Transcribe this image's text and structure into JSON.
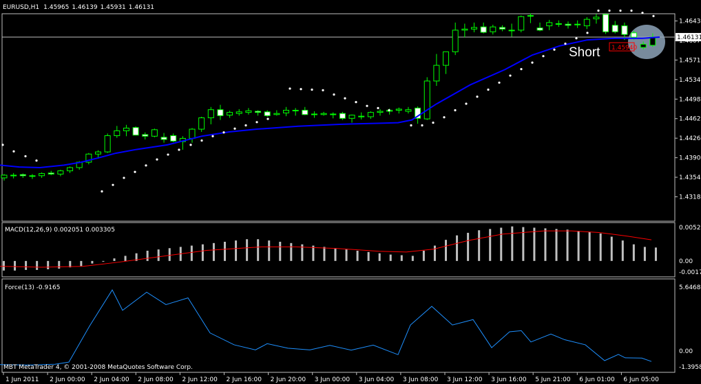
{
  "chart_data": {
    "type": "candlestick",
    "main": {
      "symbol_line": {
        "symbol": "EURUSD,H1",
        "open": "1.45965",
        "high": "1.46139",
        "low": "1.45931",
        "close": "1.46131"
      },
      "ylim": [
        1.4318,
        1.468
      ],
      "y_ticks": [
        "1.4643",
        "1.4607",
        "1.4571",
        "1.4534",
        "1.4498",
        "1.4462",
        "1.4426",
        "1.4390",
        "1.4354",
        "1.4318"
      ],
      "current_price": "1.46131",
      "sell_marker_price": "1.45940",
      "annotation": "Short",
      "candles": [
        [
          1.4353,
          1.436,
          1.4348,
          1.4358
        ],
        [
          1.4357,
          1.4362,
          1.4352,
          1.4358
        ],
        [
          1.4359,
          1.4361,
          1.4353,
          1.4357
        ],
        [
          1.4357,
          1.436,
          1.4351,
          1.4356
        ],
        [
          1.4357,
          1.4363,
          1.4353,
          1.4361
        ],
        [
          1.4362,
          1.4366,
          1.4358,
          1.436
        ],
        [
          1.436,
          1.4368,
          1.4356,
          1.4366
        ],
        [
          1.4366,
          1.4374,
          1.4362,
          1.4372
        ],
        [
          1.4372,
          1.4384,
          1.4368,
          1.4382
        ],
        [
          1.4382,
          1.4399,
          1.4378,
          1.4397
        ],
        [
          1.4397,
          1.4404,
          1.439,
          1.4401
        ],
        [
          1.4401,
          1.4435,
          1.4399,
          1.4431
        ],
        [
          1.4431,
          1.4449,
          1.4427,
          1.444
        ],
        [
          1.444,
          1.4451,
          1.443,
          1.4445
        ],
        [
          1.4446,
          1.4448,
          1.4436,
          1.4432
        ],
        [
          1.4433,
          1.4437,
          1.4424,
          1.443
        ],
        [
          1.443,
          1.4444,
          1.4428,
          1.4442
        ],
        [
          1.4428,
          1.4436,
          1.4418,
          1.4424
        ],
        [
          1.4431,
          1.4435,
          1.4419,
          1.4421
        ],
        [
          1.442,
          1.443,
          1.4405,
          1.4426
        ],
        [
          1.4426,
          1.4445,
          1.4418,
          1.4443
        ],
        [
          1.4443,
          1.4466,
          1.4438,
          1.4464
        ],
        [
          1.4464,
          1.4484,
          1.4452,
          1.4479
        ],
        [
          1.4479,
          1.4488,
          1.446,
          1.4468
        ],
        [
          1.4469,
          1.4477,
          1.4464,
          1.4474
        ],
        [
          1.4472,
          1.448,
          1.4468,
          1.4475
        ],
        [
          1.4474,
          1.4482,
          1.447,
          1.4477
        ],
        [
          1.4476,
          1.4478,
          1.4468,
          1.4474
        ],
        [
          1.4475,
          1.4478,
          1.4466,
          1.4468
        ],
        [
          1.447,
          1.4478,
          1.4468,
          1.4472
        ],
        [
          1.4473,
          1.4484,
          1.4467,
          1.4478
        ],
        [
          1.4478,
          1.4482,
          1.4468,
          1.4477
        ],
        [
          1.4478,
          1.4484,
          1.4469,
          1.447
        ],
        [
          1.4471,
          1.4476,
          1.4464,
          1.447
        ],
        [
          1.447,
          1.4475,
          1.4468,
          1.4472
        ],
        [
          1.4471,
          1.4474,
          1.4463,
          1.447
        ],
        [
          1.4472,
          1.4475,
          1.446,
          1.4463
        ],
        [
          1.4463,
          1.447,
          1.4455,
          1.4469
        ],
        [
          1.4467,
          1.4474,
          1.4461,
          1.4467
        ],
        [
          1.4466,
          1.4476,
          1.4462,
          1.4474
        ],
        [
          1.4474,
          1.448,
          1.4468,
          1.4476
        ],
        [
          1.4476,
          1.4481,
          1.447,
          1.4478
        ],
        [
          1.4478,
          1.4483,
          1.4472,
          1.448
        ],
        [
          1.4476,
          1.4484,
          1.4472,
          1.4479
        ],
        [
          1.4482,
          1.4485,
          1.4453,
          1.4463
        ],
        [
          1.4462,
          1.4539,
          1.446,
          1.4532
        ],
        [
          1.4532,
          1.4582,
          1.4523,
          1.4561
        ],
        [
          1.4561,
          1.4586,
          1.4545,
          1.4586
        ],
        [
          1.4586,
          1.464,
          1.458,
          1.4626
        ],
        [
          1.4626,
          1.4638,
          1.4613,
          1.4628
        ],
        [
          1.4628,
          1.464,
          1.4622,
          1.4631
        ],
        [
          1.4632,
          1.464,
          1.462,
          1.4622
        ],
        [
          1.4623,
          1.4636,
          1.4618,
          1.4632
        ],
        [
          1.4631,
          1.4635,
          1.4624,
          1.4628
        ],
        [
          1.4626,
          1.4638,
          1.4614,
          1.4625
        ],
        [
          1.4626,
          1.4653,
          1.4622,
          1.4651
        ],
        [
          1.4653,
          1.4657,
          1.4639,
          1.4653
        ],
        [
          1.463,
          1.464,
          1.4624,
          1.4626
        ],
        [
          1.4634,
          1.4645,
          1.4626,
          1.464
        ],
        [
          1.4638,
          1.4644,
          1.4632,
          1.4637
        ],
        [
          1.4637,
          1.4642,
          1.4629,
          1.4635
        ],
        [
          1.4637,
          1.4644,
          1.463,
          1.4636
        ],
        [
          1.4634,
          1.465,
          1.4628,
          1.4646
        ],
        [
          1.4647,
          1.4656,
          1.4638,
          1.465
        ],
        [
          1.4655,
          1.4656,
          1.4619,
          1.4623
        ],
        [
          1.4635,
          1.4643,
          1.462,
          1.4623
        ],
        [
          1.4634,
          1.464,
          1.4608,
          1.4618
        ],
        [
          1.4621,
          1.4625,
          1.4608,
          1.4613
        ],
        [
          1.4594,
          1.4605,
          1.459,
          1.46
        ],
        [
          1.4598,
          1.462,
          1.4595,
          1.4613
        ]
      ],
      "ma": [
        [
          0,
          1.43765
        ],
        [
          28,
          1.4373
        ],
        [
          58,
          1.4372
        ],
        [
          93,
          1.43765
        ],
        [
          118,
          1.4382
        ],
        [
          143,
          1.439
        ],
        [
          168,
          1.43985
        ],
        [
          198,
          1.44055
        ],
        [
          243,
          1.4414
        ],
        [
          293,
          1.443
        ],
        [
          333,
          1.4438
        ],
        [
          373,
          1.4443
        ],
        [
          433,
          1.44485
        ],
        [
          493,
          1.4452
        ],
        [
          553,
          1.4454
        ],
        [
          578,
          1.4455
        ],
        [
          598,
          1.446
        ],
        [
          633,
          1.4489
        ],
        [
          683,
          1.4525
        ],
        [
          733,
          1.4553
        ],
        [
          773,
          1.458
        ],
        [
          813,
          1.4597
        ],
        [
          853,
          1.4608
        ],
        [
          893,
          1.4611
        ],
        [
          933,
          1.4611
        ],
        [
          958,
          1.46131
        ]
      ],
      "sar": [
        [
          4,
          1.4414
        ],
        [
          20,
          1.4402
        ],
        [
          37,
          1.4393
        ],
        [
          53,
          1.4385
        ],
        [
          148,
          1.4328
        ],
        [
          164,
          1.434
        ],
        [
          180,
          1.4353
        ],
        [
          196,
          1.4364
        ],
        [
          212,
          1.4376
        ],
        [
          228,
          1.4387
        ],
        [
          244,
          1.4396
        ],
        [
          260,
          1.4405
        ],
        [
          277,
          1.4414
        ],
        [
          293,
          1.4422
        ],
        [
          309,
          1.443
        ],
        [
          325,
          1.4437
        ],
        [
          341,
          1.4444
        ],
        [
          357,
          1.445
        ],
        [
          373,
          1.4456
        ],
        [
          389,
          1.4462
        ],
        [
          421,
          1.4518
        ],
        [
          437,
          1.4517
        ],
        [
          453,
          1.4516
        ],
        [
          469,
          1.4515
        ],
        [
          485,
          1.4507
        ],
        [
          501,
          1.45
        ],
        [
          517,
          1.4493
        ],
        [
          533,
          1.4486
        ],
        [
          549,
          1.4482
        ],
        [
          565,
          1.4478
        ],
        [
          597,
          1.445
        ],
        [
          613,
          1.445
        ],
        [
          629,
          1.4455
        ],
        [
          645,
          1.4465
        ],
        [
          661,
          1.4478
        ],
        [
          677,
          1.449
        ],
        [
          693,
          1.4503
        ],
        [
          709,
          1.4516
        ],
        [
          725,
          1.4529
        ],
        [
          741,
          1.4542
        ],
        [
          757,
          1.4554
        ],
        [
          773,
          1.4566
        ],
        [
          789,
          1.4578
        ],
        [
          805,
          1.459
        ],
        [
          821,
          1.4601
        ],
        [
          837,
          1.4611
        ],
        [
          853,
          1.4621
        ],
        [
          869,
          1.4662
        ],
        [
          885,
          1.4662
        ],
        [
          901,
          1.4662
        ],
        [
          917,
          1.4662
        ],
        [
          933,
          1.4658
        ],
        [
          949,
          1.4652
        ]
      ]
    },
    "macd": {
      "title": "MACD(12,26,9) 0.002051 0.003305",
      "y_ticks": [
        "0.00525",
        "0.00",
        "-0.00173"
      ],
      "ylim": [
        -0.00173,
        0.00525
      ],
      "histogram": [
        -0.0015,
        -0.0015,
        -0.0014,
        -0.0014,
        -0.0013,
        -0.0012,
        -0.001,
        -0.0008,
        -0.0004,
        0.0,
        0.0004,
        0.0008,
        0.0012,
        0.0016,
        0.0018,
        0.002,
        0.0022,
        0.0024,
        0.0026,
        0.0028,
        0.003,
        0.0032,
        0.0034,
        0.0034,
        0.0032,
        0.003,
        0.0028,
        0.0026,
        0.0024,
        0.0022,
        0.002,
        0.0018,
        0.0016,
        0.0014,
        0.0012,
        0.001,
        0.0009,
        0.0008,
        0.0016,
        0.0024,
        0.0033,
        0.004,
        0.0044,
        0.0048,
        0.005,
        0.0052,
        0.0054,
        0.0053,
        0.0052,
        0.0051,
        0.005,
        0.0049,
        0.0047,
        0.0045,
        0.0043,
        0.0038,
        0.0032,
        0.0026,
        0.0022,
        0.0021
      ],
      "signal": [
        [
          0,
          -0.00083
        ],
        [
          60,
          -0.00098
        ],
        [
          120,
          -0.00085
        ],
        [
          170,
          -0.00022
        ],
        [
          230,
          0.00065
        ],
        [
          300,
          0.00165
        ],
        [
          380,
          0.0022
        ],
        [
          430,
          0.0022
        ],
        [
          490,
          0.00195
        ],
        [
          550,
          0.00152
        ],
        [
          590,
          0.0014
        ],
        [
          630,
          0.00185
        ],
        [
          680,
          0.0032
        ],
        [
          730,
          0.0042
        ],
        [
          790,
          0.0047
        ],
        [
          830,
          0.0047
        ],
        [
          870,
          0.00445
        ],
        [
          910,
          0.0039
        ],
        [
          946,
          0.0033
        ]
      ]
    },
    "force": {
      "title": "Force(13) -0.9165",
      "y_ticks": [
        "5.6468",
        "0.00",
        "-1.3958"
      ],
      "ylim": [
        -1.3958,
        5.6468
      ],
      "series": [
        [
          0,
          -1.2
        ],
        [
          40,
          -1.24
        ],
        [
          80,
          -1.17
        ],
        [
          100,
          -0.98
        ],
        [
          130,
          2.2
        ],
        [
          163,
          5.4
        ],
        [
          178,
          3.6
        ],
        [
          213,
          5.2
        ],
        [
          241,
          4.1
        ],
        [
          273,
          4.7
        ],
        [
          305,
          1.6
        ],
        [
          340,
          0.55
        ],
        [
          371,
          0.1
        ],
        [
          388,
          0.65
        ],
        [
          418,
          0.25
        ],
        [
          450,
          0.1
        ],
        [
          479,
          0.5
        ],
        [
          510,
          0.08
        ],
        [
          542,
          0.52
        ],
        [
          578,
          -0.32
        ],
        [
          596,
          2.3
        ],
        [
          627,
          3.95
        ],
        [
          657,
          2.3
        ],
        [
          687,
          2.78
        ],
        [
          714,
          0.3
        ],
        [
          740,
          1.7
        ],
        [
          757,
          1.8
        ],
        [
          771,
          0.8
        ],
        [
          800,
          1.5
        ],
        [
          820,
          1.0
        ],
        [
          850,
          0.55
        ],
        [
          878,
          -0.85
        ],
        [
          898,
          -0.3
        ],
        [
          908,
          -0.6
        ],
        [
          932,
          -0.62
        ],
        [
          946,
          -0.92
        ]
      ]
    },
    "time_axis": [
      "1 Jun 2011",
      "2 Jun 00:00",
      "2 Jun 04:00",
      "2 Jun 08:00",
      "2 Jun 12:00",
      "2 Jun 16:00",
      "2 Jun 20:00",
      "3 Jun 00:00",
      "3 Jun 04:00",
      "3 Jun 08:00",
      "3 Jun 12:00",
      "3 Jun 16:00",
      "5 Jun 21:00",
      "6 Jun 01:00",
      "6 Jun 05:00"
    ],
    "footer": "MBT MetaTrader 4, © 2001-2008 MetaQuotes Software Corp.",
    "colors": {
      "background": "#000000",
      "bull_candle": "#00ff00",
      "bear_candle": "#ffffff",
      "moving_average": "#0000ff",
      "parabolic_sar": "#ffffff",
      "macd_histogram": "#c0c0c0",
      "macd_signal": "#ff0000",
      "force_line": "#1e90ff",
      "sell_marker": "#ff0000"
    }
  }
}
